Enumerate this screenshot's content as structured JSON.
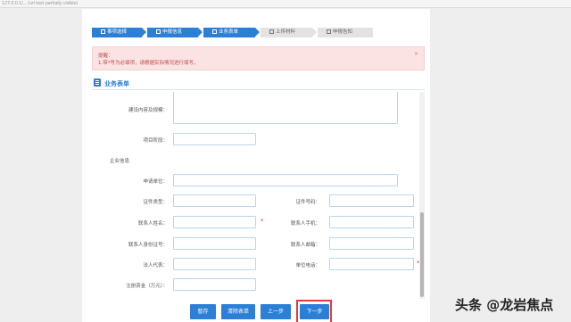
{
  "browser": {
    "url": "127.0.0.1/... (url text partially visible)"
  },
  "steps": [
    {
      "label": "事项选择",
      "state": "active"
    },
    {
      "label": "申报信息",
      "state": "active"
    },
    {
      "label": "业务表单",
      "state": "active"
    },
    {
      "label": "上传材料",
      "state": "inactive"
    },
    {
      "label": "申报告知",
      "state": "inactive"
    }
  ],
  "alert": {
    "title": "提醒：",
    "message": "1.带*号为必填项，请根据实际情况进行填写。",
    "close": "×"
  },
  "section": {
    "title": "业务表单"
  },
  "form": {
    "field_construction_content": "建设内容及规模：",
    "field_project_level": "项目阶段：",
    "group_enterprise": "企业信息",
    "field_applicant": "申请单位：",
    "field_id_type": "证件类型：",
    "field_id_number": "证件号码：",
    "field_contact_name": "联系人姓名：",
    "field_contact_phone": "联系人手机：",
    "field_contact_idno": "联系人身份证号：",
    "field_contact_email": "联系人邮箱：",
    "field_legal_rep": "法人代表：",
    "field_unit_phone": "单位电话：",
    "field_registered_capital": "注册资金（万元）：",
    "required_mark": "*"
  },
  "buttons": {
    "save": "暂存",
    "clear": "清除表单",
    "prev": "上一步",
    "next": "下一步"
  },
  "watermark": {
    "text": "头条 @龙岩焦点"
  },
  "colors": {
    "accent": "#2b7fd6",
    "alert_bg": "#fbe3e4",
    "alert_text": "#b94a48",
    "highlight": "#e13a3a",
    "required": "#e23b3b"
  }
}
